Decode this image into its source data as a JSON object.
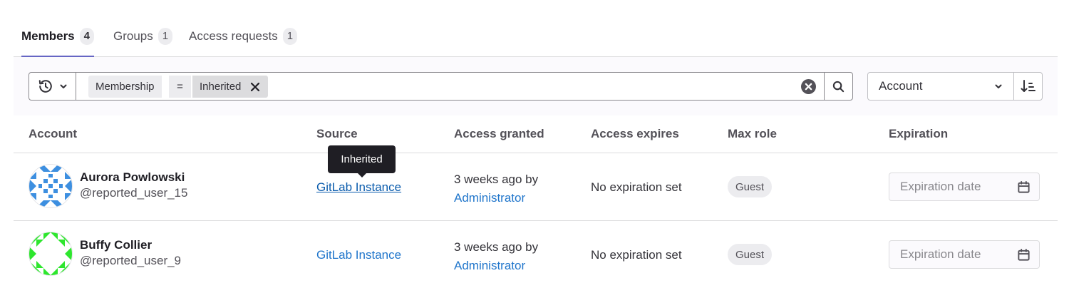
{
  "tabs": [
    {
      "label": "Members",
      "count": "4"
    },
    {
      "label": "Groups",
      "count": "1"
    },
    {
      "label": "Access requests",
      "count": "1"
    }
  ],
  "filter": {
    "token_field": "Membership",
    "token_operator": "=",
    "token_value": "Inherited"
  },
  "sort": {
    "selected": "Account"
  },
  "table": {
    "headers": {
      "account": "Account",
      "source": "Source",
      "access_granted": "Access granted",
      "access_expires": "Access expires",
      "max_role": "Max role",
      "expiration": "Expiration"
    },
    "rows": [
      {
        "name": "Aurora Powlowski",
        "username": "@reported_user_15",
        "source": "GitLab Instance",
        "granted_text": "3 weeks ago by",
        "granted_by": "Administrator",
        "expires": "No expiration set",
        "role": "Guest",
        "expiration_placeholder": "Expiration date"
      },
      {
        "name": "Buffy Collier",
        "username": "@reported_user_9",
        "source": "GitLab Instance",
        "granted_text": "3 weeks ago by",
        "granted_by": "Administrator",
        "expires": "No expiration set",
        "role": "Guest",
        "expiration_placeholder": "Expiration date"
      }
    ]
  },
  "tooltip": "Inherited",
  "colors": {
    "accent": "#6666c4",
    "link": "#1f75cb",
    "avatar1": "#3d8fe0",
    "avatar2": "#2ee62e"
  }
}
